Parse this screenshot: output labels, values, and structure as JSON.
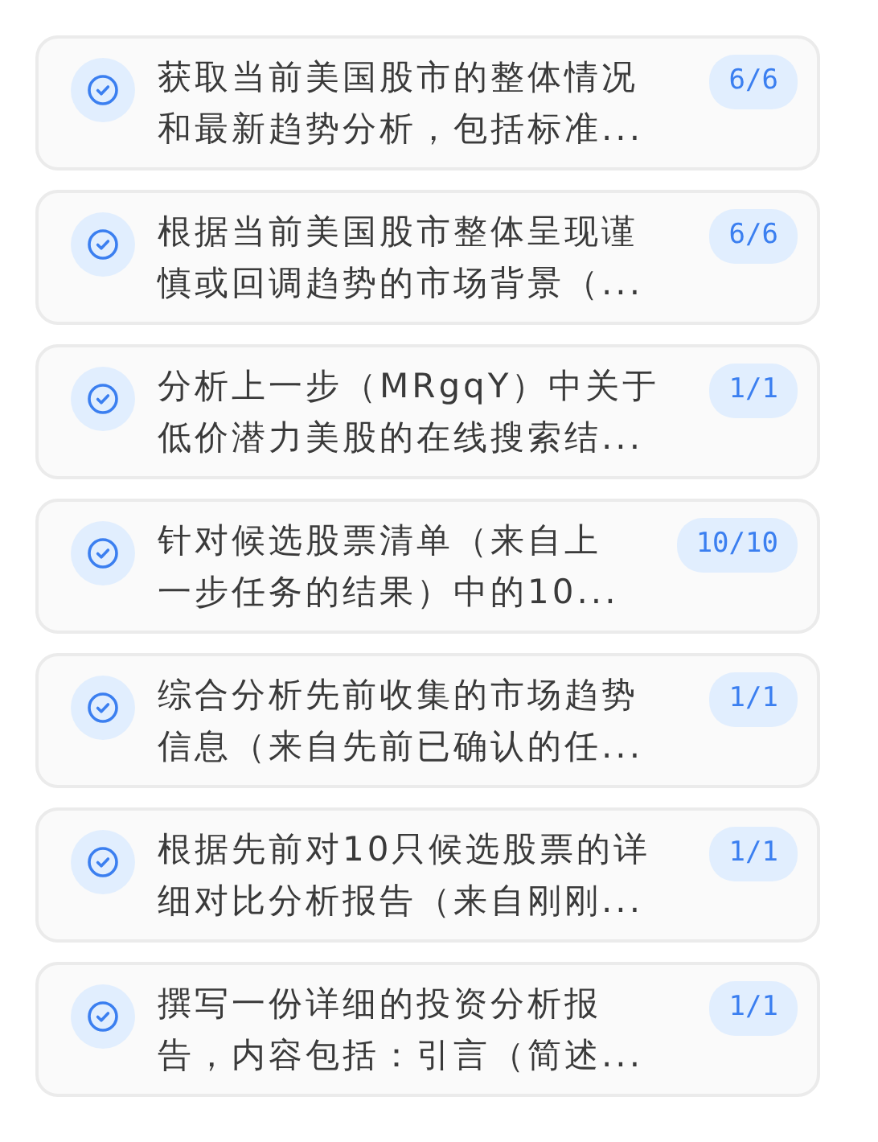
{
  "tasks": [
    {
      "lines": [
        "获取当前美国股市的整体情况",
        "和最新趋势分析，包括标准..."
      ],
      "progress": "6/6",
      "done": true
    },
    {
      "lines": [
        "根据当前美国股市整体呈现谨",
        "慎或回调趋势的市场背景（..."
      ],
      "progress": "6/6",
      "done": true
    },
    {
      "lines": [
        "分析上一步（MRgqY）中关于",
        "低价潜力美股的在线搜索结..."
      ],
      "progress": "1/1",
      "done": true
    },
    {
      "lines": [
        "针对候选股票清单（来自上",
        "一步任务的结果）中的10..."
      ],
      "progress": "10/10",
      "done": true
    },
    {
      "lines": [
        "综合分析先前收集的市场趋势",
        "信息（来自先前已确认的任..."
      ],
      "progress": "1/1",
      "done": true
    },
    {
      "lines": [
        "根据先前对10只候选股票的详",
        "细对比分析报告（来自刚刚..."
      ],
      "progress": "1/1",
      "done": true
    },
    {
      "lines": [
        "撰写一份详细的投资分析报",
        "告，内容包括：引言（简述..."
      ],
      "progress": "1/1",
      "done": true
    }
  ]
}
